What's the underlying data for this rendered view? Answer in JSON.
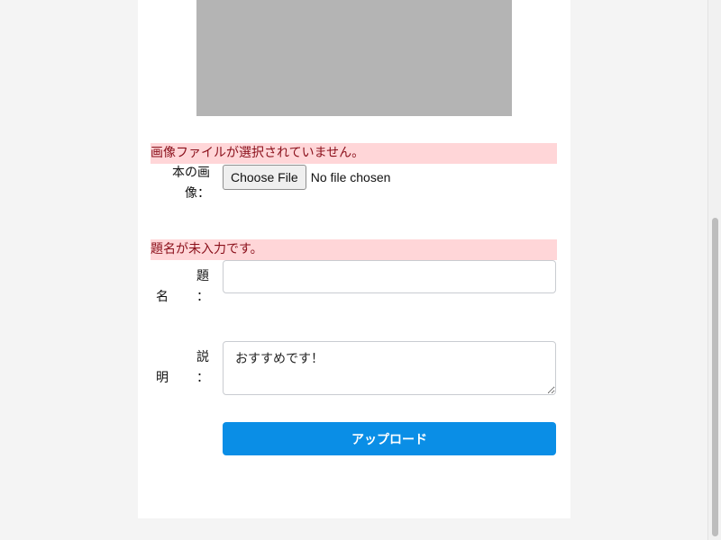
{
  "form": {
    "image_error": "画像ファイルが選択されていません。",
    "image_label": "本の画像：",
    "file_button": "Choose File",
    "file_status": "No file chosen",
    "title_error": "題名が未入力です。",
    "title_label_top": "題",
    "title_label_bottom": "名",
    "title_label_colon": "：",
    "title_value": "",
    "description_label_top": "説",
    "description_label_bottom": "明",
    "description_label_colon": "：",
    "description_value": "おすすめです！",
    "upload_button": "アップロード"
  },
  "colors": {
    "error_background": "#ffd6d8",
    "error_text": "#8a0f1a",
    "primary_button": "#0a8ee6",
    "preview_placeholder": "#b4b4b4"
  }
}
